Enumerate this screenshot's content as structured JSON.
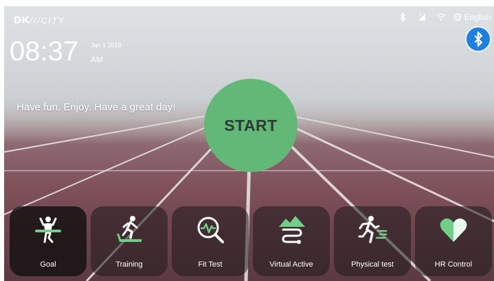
{
  "brand": {
    "logo_text": "DK",
    "logo_sub": "CITY"
  },
  "clock": {
    "time": "08:37",
    "date": "Jan 1 2018",
    "ampm": "AM"
  },
  "status_bar": {
    "language": "English"
  },
  "slogan": "Have fun. Enjoy. Have a great day!",
  "start_label": "START",
  "menu": [
    {
      "label": "Goal",
      "icon": "finish-line-runner-icon",
      "active": true
    },
    {
      "label": "Training",
      "icon": "treadmill-runner-icon",
      "active": false
    },
    {
      "label": "Fit Test",
      "icon": "heart-rate-magnifier-icon",
      "active": false
    },
    {
      "label": "Virtual Active",
      "icon": "mountain-path-icon",
      "active": false
    },
    {
      "label": "Physical test",
      "icon": "sprinter-icon",
      "active": false
    },
    {
      "label": "HR Control",
      "icon": "heart-icon",
      "active": false
    }
  ],
  "colors": {
    "accent_green": "#62b877",
    "icon_green": "#6fcf87",
    "bluetooth_blue": "#1e7fe0"
  }
}
